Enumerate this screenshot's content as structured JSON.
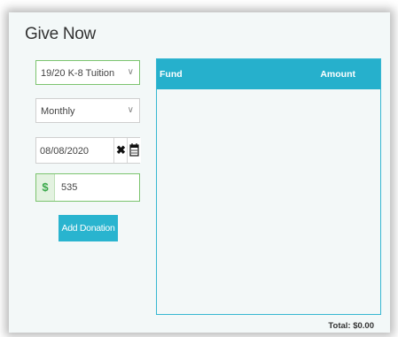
{
  "title": "Give Now",
  "form": {
    "fund_select": {
      "value": "19/20 K-8 Tuition"
    },
    "frequency_select": {
      "value": "Monthly"
    },
    "date_field": {
      "value": "08/08/2020"
    },
    "amount_field": {
      "currency_symbol": "$",
      "value": "535"
    },
    "add_button_label": "Add Donation"
  },
  "table": {
    "columns": [
      "Fund",
      "Amount"
    ],
    "rows": []
  },
  "total_label": "Total: $0.00",
  "icons": {
    "dropdown": "chevron-down-icon",
    "clear": "close-icon",
    "calendar": "calendar-icon"
  },
  "colors": {
    "accent": "#29b4cf",
    "valid_border": "#7cc46f",
    "background": "#f3f8f8"
  }
}
